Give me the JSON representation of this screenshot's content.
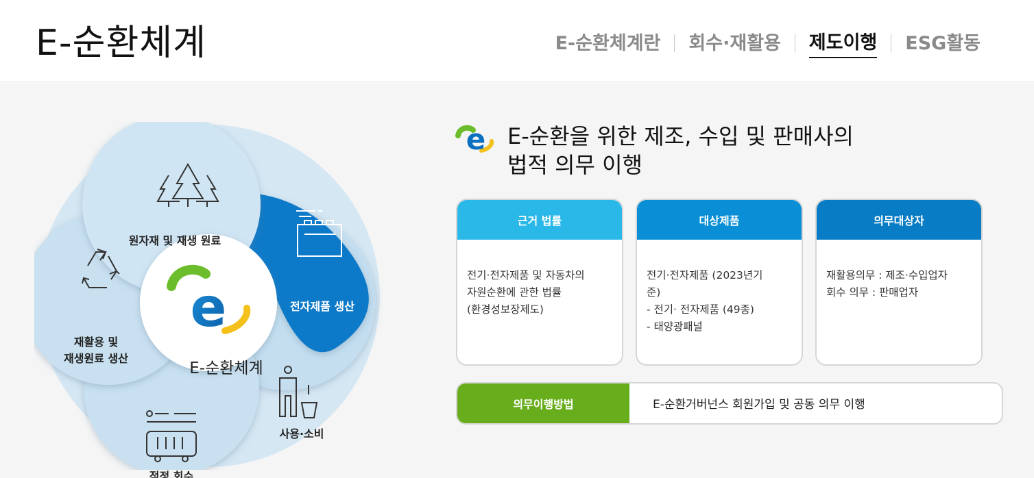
{
  "site": {
    "title": "E-순환체계"
  },
  "nav": {
    "items": [
      {
        "label": "E-순환체계란"
      },
      {
        "label": "회수·재활용"
      },
      {
        "label": "제도이행"
      },
      {
        "label": "ESG활동"
      }
    ],
    "active_index": 2
  },
  "diagram": {
    "center_label": "E-순환체계",
    "segments": [
      {
        "label": "원자재 및 재생 원료",
        "icon": "trees-icon"
      },
      {
        "label": "전자제품 생산",
        "icon": "factory-icon"
      },
      {
        "label": "사용·소비",
        "icon": "person-trash-icon"
      },
      {
        "label": "적정 회수",
        "icon": "truck-icon"
      },
      {
        "label_line1": "재활용 및",
        "label_line2": "재생원료 생산",
        "icon": "recycle-icon"
      }
    ],
    "colors": {
      "light": "#c7dff0",
      "dark": "#0a7ac9",
      "ring_bg": "#d5e7f3"
    }
  },
  "heading": {
    "line1": "E-순환을 위한 제조, 수입 및 판매사의",
    "line2": "법적 의무 이행",
    "icon": "e-logo-icon"
  },
  "cards": [
    {
      "title": "근거 법률",
      "color": "#2ab8e8",
      "lines": [
        "전기·전자제품 및 자동차의",
        "자원순환에 관한 법률",
        "(환경성보장제도)"
      ]
    },
    {
      "title": "대상제품",
      "color": "#0a8fd6",
      "lines": [
        "전기·전자제품 (2023년기",
        "준)",
        "- 전기· 전자제품 (49종)",
        "- 태양광패널"
      ]
    },
    {
      "title": "의무대상자",
      "color": "#087cc4",
      "lines": [
        "재활용의무 : 제조·수입업자",
        "회수 의무 : 판매업자"
      ]
    }
  ],
  "method": {
    "title": "의무이행방법",
    "text": "E-순환거버넌스 회원가입 및 공동 의무 이행",
    "color": "#68ad1c"
  }
}
